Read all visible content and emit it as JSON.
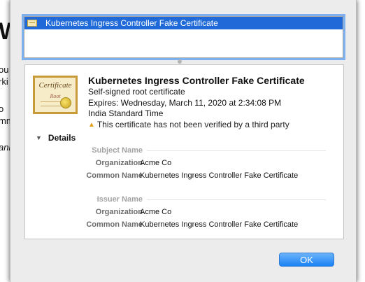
{
  "background_fragments": {
    "heading": "We",
    "line1": "ou",
    "line2": "rki",
    "line3": "o",
    "line4": "mm",
    "line5": "ani"
  },
  "chain": {
    "items": [
      {
        "label": "Kubernetes Ingress Controller Fake Certificate",
        "selected": true,
        "icon": "certificate-icon"
      }
    ]
  },
  "certificate": {
    "icon_text_main": "Certificate",
    "icon_text_sub": "Root",
    "title": "Kubernetes Ingress Controller Fake Certificate",
    "subtitle": "Self-signed root certificate",
    "expires": "Expires: Wednesday, March 11, 2020 at 2:34:08 PM India Standard Time",
    "warning": "This certificate has not been verified by a third party",
    "warning_icon": "warning-icon"
  },
  "details": {
    "toggle_label": "Details",
    "subject": {
      "section_label": "Subject Name",
      "organization_key": "Organization",
      "organization_value": "Acme Co",
      "common_name_key": "Common Name",
      "common_name_value": "Kubernetes Ingress Controller Fake Certificate"
    },
    "issuer": {
      "section_label": "Issuer Name",
      "organization_key": "Organization",
      "organization_value": "Acme Co",
      "common_name_key": "Common Name",
      "common_name_value": "Kubernetes Ingress Controller Fake Certificate"
    }
  },
  "buttons": {
    "ok_label": "OK"
  },
  "colors": {
    "selection": "#1f6ad8",
    "ok_button": "#1a82f5",
    "warning": "#e3a21b"
  }
}
